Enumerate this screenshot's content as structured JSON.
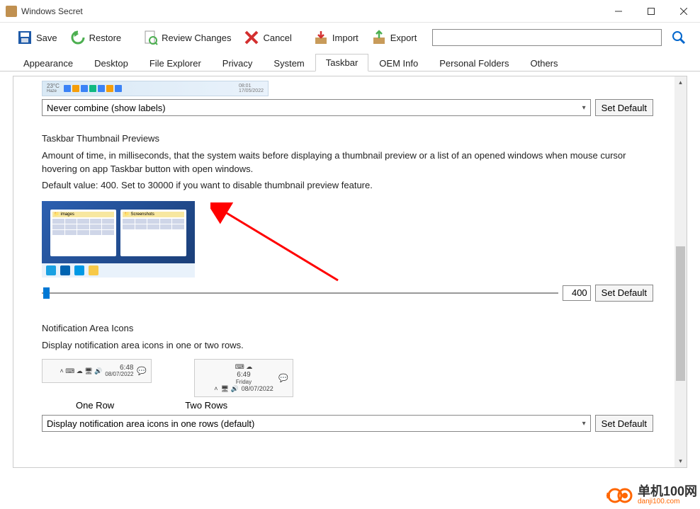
{
  "window": {
    "title": "Windows Secret"
  },
  "toolbar": {
    "save": "Save",
    "restore": "Restore",
    "review": "Review Changes",
    "cancel": "Cancel",
    "import": "Import",
    "export": "Export",
    "search_placeholder": ""
  },
  "tabs": [
    "Appearance",
    "Desktop",
    "File Explorer",
    "Privacy",
    "System",
    "Taskbar",
    "OEM Info",
    "Personal Folders",
    "Others"
  ],
  "active_tab": "Taskbar",
  "combine": {
    "value": "Never combine (show labels)",
    "set_default": "Set Default",
    "strip_weather": "23°C",
    "strip_haze": "Haze",
    "strip_time": "08:01",
    "strip_date": "17/05/2022"
  },
  "thumb": {
    "title": "Taskbar Thumbnail Previews",
    "desc1": "Amount of time, in milliseconds, that the system waits before displaying a thumbnail preview or a list of an opened windows when mouse cursor hovering on app Taskbar button with open windows.",
    "desc2": "Default value: 400. Set to 30000 if you want to disable thumbnail preview feature.",
    "win1": "images",
    "win2": "Screenshots",
    "value": "400",
    "set_default": "Set Default"
  },
  "notif": {
    "title": "Notification Area Icons",
    "desc": "Display notification area icons in one or two rows.",
    "one_time": "6:48",
    "one_date": "08/07/2022",
    "two_time": "6:49",
    "two_day": "Friday",
    "two_date": "08/07/2022",
    "label_one": "One Row",
    "label_two": "Two Rows",
    "combo": "Display notification area icons in one rows (default)",
    "set_default": "Set Default"
  },
  "watermark": {
    "name": "单机100网",
    "url": "danji100.com"
  }
}
